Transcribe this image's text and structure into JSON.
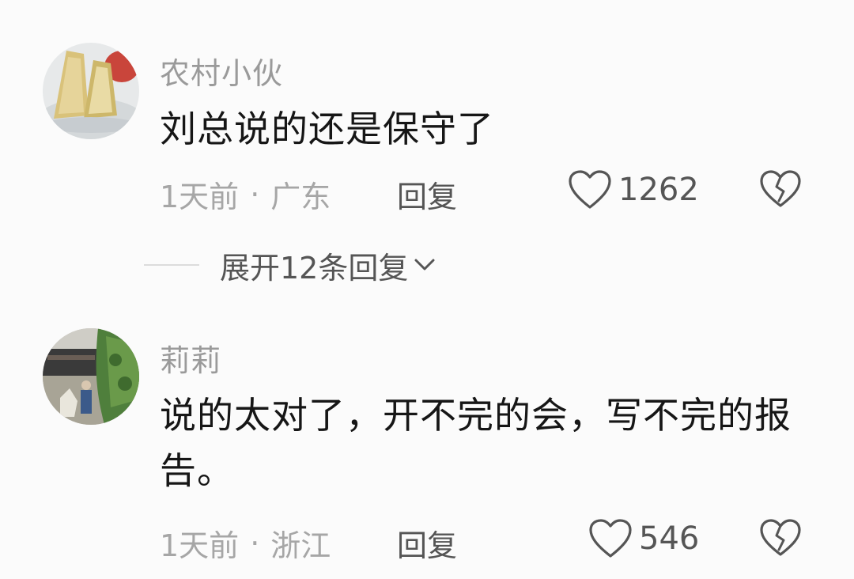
{
  "comments": [
    {
      "username": "农村小伙",
      "text": "刘总说的还是保守了",
      "time": "1天前",
      "separator": "·",
      "location": "广东",
      "reply_label": "回复",
      "likes": "1262"
    },
    {
      "username": "莉莉",
      "text": "说的太对了，开不完的会，写不完的报告。",
      "time": "1天前",
      "separator": "·",
      "location": "浙江",
      "reply_label": "回复",
      "likes": "546"
    }
  ],
  "expand_replies": {
    "label": "展开12条回复"
  },
  "icons": {
    "like": "heart-outline-icon",
    "dislike": "broken-heart-icon",
    "expand": "chevron-down-icon"
  },
  "colors": {
    "background": "#fbfbfb",
    "username": "#9a9a9a",
    "text": "#161616",
    "meta": "#a6a6a6",
    "action": "#555555"
  }
}
